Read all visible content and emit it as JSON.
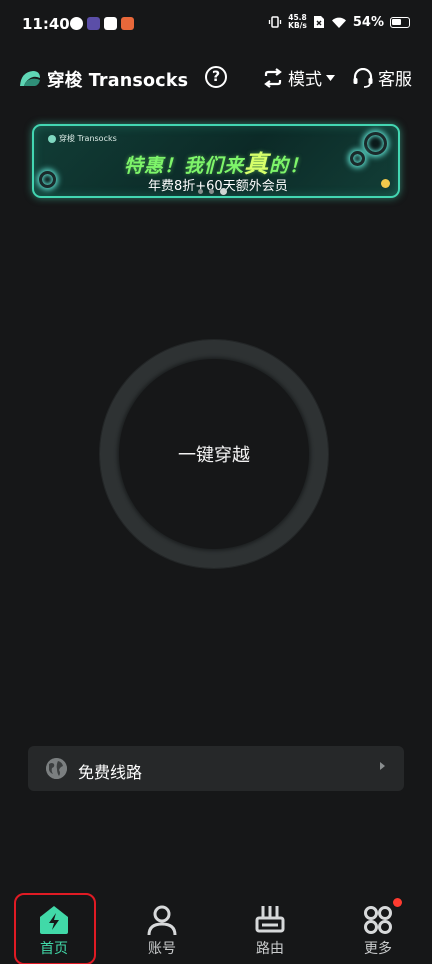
{
  "status_bar": {
    "time": "11:40",
    "net_speed_value": "45.8",
    "net_speed_unit": "KB/s",
    "battery": "54%"
  },
  "header": {
    "app_title": "穿梭 Transocks",
    "help_label": "?",
    "mode_label": "模式",
    "service_label": "客服"
  },
  "banner": {
    "brand": "穿梭 Transocks",
    "headline_part1": "特惠！我们来",
    "headline_big": "真",
    "headline_part2": "的！",
    "subline": "年费8折+60天额外会员",
    "page_count": 3,
    "active_page": 2
  },
  "connect": {
    "label": "一键穿越"
  },
  "route": {
    "label": "免费线路"
  },
  "bottom_nav": {
    "items": [
      {
        "label": "首页",
        "icon": "home-bolt-icon",
        "active": true
      },
      {
        "label": "账号",
        "icon": "user-icon",
        "active": false
      },
      {
        "label": "路由",
        "icon": "router-icon",
        "active": false
      },
      {
        "label": "更多",
        "icon": "grid-dots-icon",
        "active": false,
        "badge": true
      }
    ]
  },
  "colors": {
    "background": "#161718",
    "accent": "#41d9a8",
    "banner_border": "#43d6b2",
    "headline_green": "#7ef56a",
    "badge_red": "#ff3b30",
    "highlight_red": "#e01b24"
  }
}
